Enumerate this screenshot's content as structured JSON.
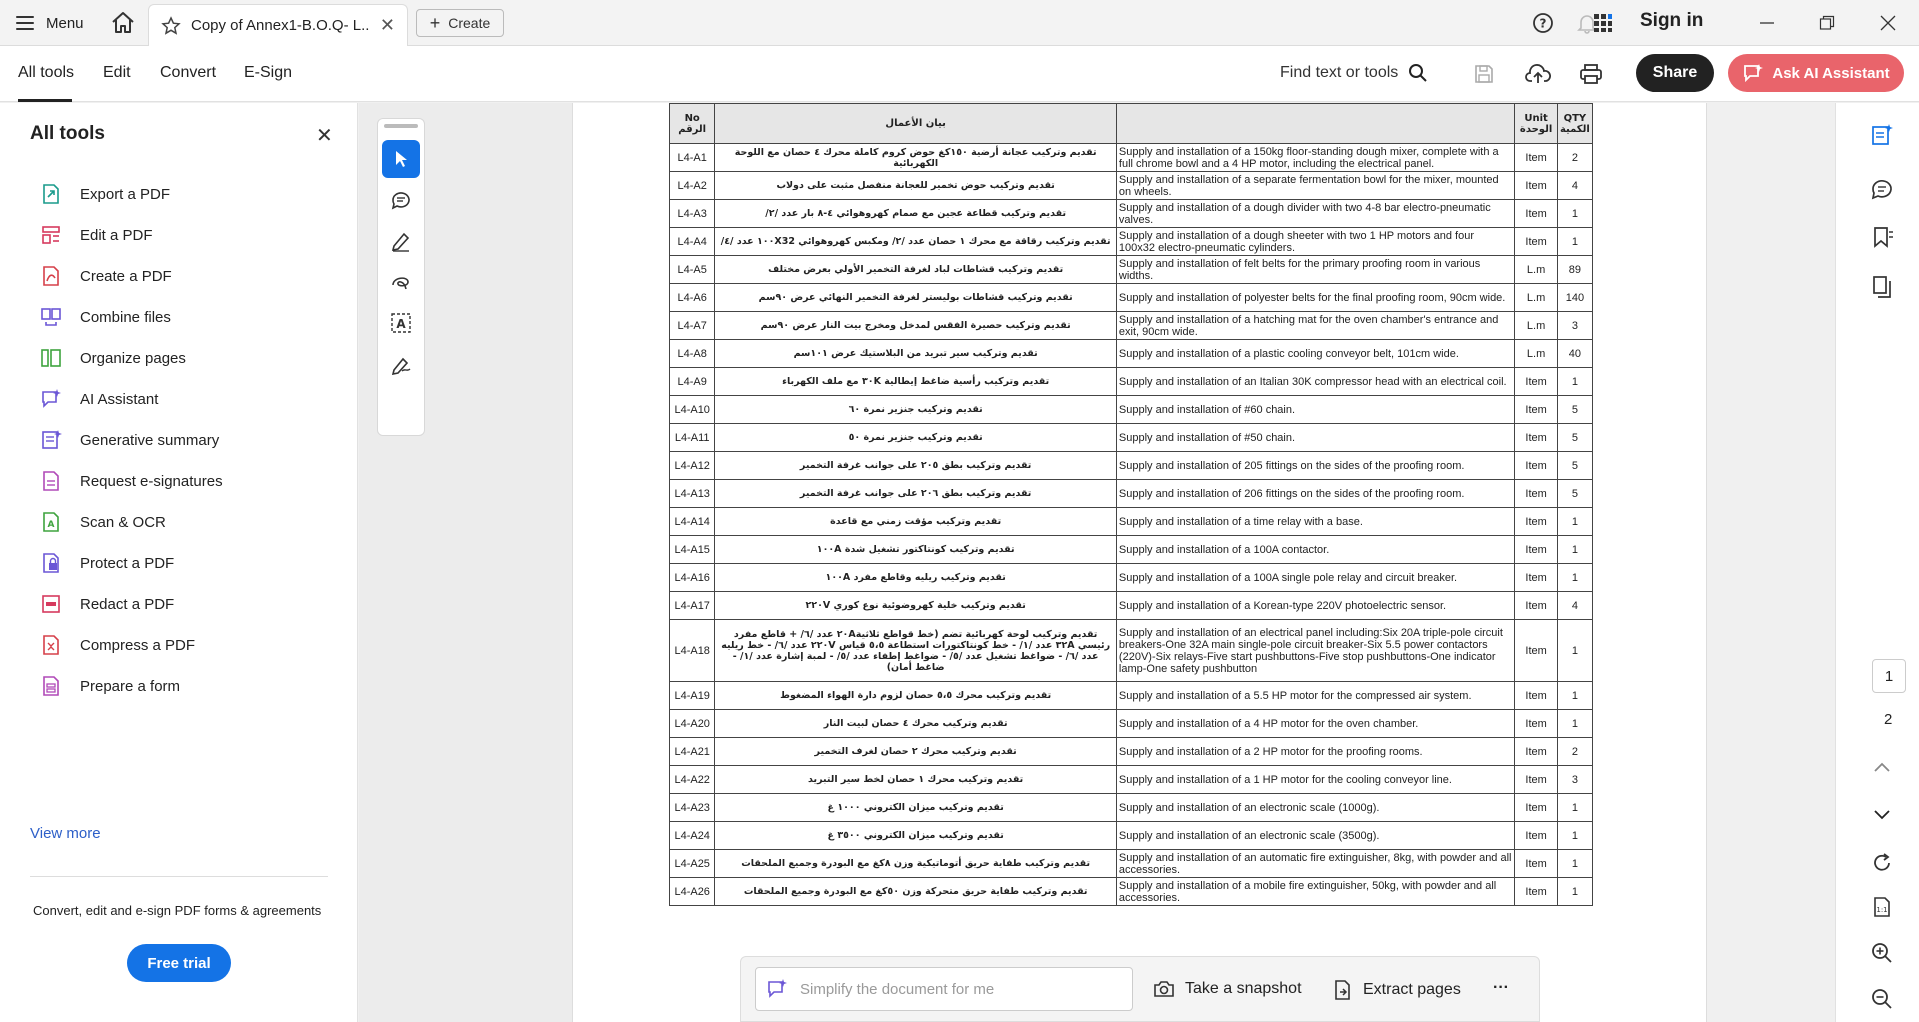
{
  "titlebar": {
    "menu_label": "Menu",
    "tab_title": "Copy of Annex1-B.O.Q- L...",
    "create_label": "Create",
    "signin_label": "Sign in"
  },
  "toolbar": {
    "tabs": [
      "All tools",
      "Edit",
      "Convert",
      "E-Sign"
    ],
    "find_label": "Find text or tools",
    "share_label": "Share",
    "ai_label": "Ask AI Assistant"
  },
  "left_panel": {
    "title": "All tools",
    "items": [
      {
        "label": "Export a PDF",
        "color": "#1a9b8c"
      },
      {
        "label": "Edit a PDF",
        "color": "#d63a5e"
      },
      {
        "label": "Create a PDF",
        "color": "#d6404a"
      },
      {
        "label": "Combine files",
        "color": "#6b57d6"
      },
      {
        "label": "Organize pages",
        "color": "#3ea33e"
      },
      {
        "label": "AI Assistant",
        "color": "#6b57d6"
      },
      {
        "label": "Generative summary",
        "color": "#6b57d6"
      },
      {
        "label": "Request e-signatures",
        "color": "#b14ab8"
      },
      {
        "label": "Scan & OCR",
        "color": "#3ea33e"
      },
      {
        "label": "Protect a PDF",
        "color": "#6b57d6"
      },
      {
        "label": "Redact a PDF",
        "color": "#d63a5e"
      },
      {
        "label": "Compress a PDF",
        "color": "#d6404a"
      },
      {
        "label": "Prepare a form",
        "color": "#b14ab8"
      }
    ],
    "view_more": "View more",
    "tagline": "Convert, edit and e-sign PDF forms & agreements",
    "trial_label": "Free trial"
  },
  "table": {
    "headers": {
      "no": "No\nالرقم",
      "ar": "بيان الأعمال",
      "en": "",
      "unit": "Unit\nالوحدة",
      "qty": "QTY\nالكمية"
    },
    "rows": [
      {
        "no": "L4-A1",
        "ar": "تقديم وتركيب عجانة أرضية ١٥٠كغ حوض كروم كاملة محرك ٤ حصان مع اللوحة الكهربائية",
        "en": "Supply and installation of a 150kg floor-standing dough mixer, complete with a full chrome bowl and a 4 HP motor, including the electrical panel.",
        "unit": "Item",
        "qty": "2"
      },
      {
        "no": "L4-A2",
        "ar": "تقديم وتركيب حوض تخمير للعجانة منفصل مثبت على دولاب",
        "en": "Supply and installation of a separate fermentation bowl for the mixer, mounted on wheels.",
        "unit": "Item",
        "qty": "4"
      },
      {
        "no": "L4-A3",
        "ar": "تقديم وتركيب قطاعة عجين مع صمام كهروهوائي ٤-٨ بار عدد /٢/",
        "en": "Supply and installation of a dough divider with two 4-8 bar electro-pneumatic valves.",
        "unit": "Item",
        "qty": "1"
      },
      {
        "no": "L4-A4",
        "ar": "تقديم وتركيب رقاقة مع محرك ١ حصان عدد /٢/ ومكبس كهروهوائي ١٠٠X32 عدد /٤/",
        "en": "Supply and installation of a dough sheeter with two 1 HP motors and four 100x32 electro-pneumatic cylinders.",
        "unit": "Item",
        "qty": "1"
      },
      {
        "no": "L4-A5",
        "ar": "تقديم وتركيب قشاطات لباد لغرفة التخمير الأولي بعرض مختلف",
        "en": "Supply and installation of felt belts for the primary proofing room in various widths.",
        "unit": "L.m",
        "qty": "89"
      },
      {
        "no": "L4-A6",
        "ar": "تقديم وتركيب قشاطات بوليستر لغرفة التخمير النهائي عرض ٩٠سم",
        "en": "Supply and installation of polyester belts for the final proofing room, 90cm wide.",
        "unit": "L.m",
        "qty": "140"
      },
      {
        "no": "L4-A7",
        "ar": "تقديم وتركيب حصيرة الفقس لمدخل ومخرج بيت النار عرض ٩٠سم",
        "en": "Supply and installation of a hatching mat for the oven chamber's entrance and exit, 90cm wide.",
        "unit": "L.m",
        "qty": "3"
      },
      {
        "no": "L4-A8",
        "ar": "تقديم وتركيب سير تبريد من البلاستيك عرض ١٠١سم",
        "en": "Supply and installation of a plastic cooling conveyor belt, 101cm wide.",
        "unit": "L.m",
        "qty": "40"
      },
      {
        "no": "L4-A9",
        "ar": "تقديم وتركيب رأسية ضاغط إيطالية ٣٠K مع ملف الكهرباء",
        "en": "Supply and installation of an Italian 30K compressor head with an electrical coil.",
        "unit": "Item",
        "qty": "1"
      },
      {
        "no": "L4-A10",
        "ar": "تقديم وتركيب جنزير نمرة ٦٠",
        "en": "Supply and installation of #60 chain.",
        "unit": "Item",
        "qty": "5"
      },
      {
        "no": "L4-A11",
        "ar": "تقديم وتركيب جنزير نمرة ٥٠",
        "en": "Supply and installation of #50 chain.",
        "unit": "Item",
        "qty": "5"
      },
      {
        "no": "L4-A12",
        "ar": "تقديم وتركيب بطق ٢٠٥ على جوانب غرفة التخمير",
        "en": "Supply and installation of 205 fittings on the sides of the proofing room.",
        "unit": "Item",
        "qty": "5"
      },
      {
        "no": "L4-A13",
        "ar": "تقديم وتركيب بطق ٢٠٦ على جوانب غرفة التخمير",
        "en": "Supply and installation of 206 fittings on the sides of the proofing room.",
        "unit": "Item",
        "qty": "5"
      },
      {
        "no": "L4-A14",
        "ar": "تقديم وتركيب مؤقت زمني مع قاعدة",
        "en": "Supply and installation of a time relay with a base.",
        "unit": "Item",
        "qty": "1"
      },
      {
        "no": "L4-A15",
        "ar": "تقديم وتركيب كونتاكتور تشغيل شدة ١٠٠A",
        "en": "Supply and installation of a 100A contactor.",
        "unit": "Item",
        "qty": "1"
      },
      {
        "no": "L4-A16",
        "ar": "تقديم وتركيب ريليه وقاطع مفرد ١٠٠A",
        "en": "Supply and installation of a 100A single pole relay and circuit breaker.",
        "unit": "Item",
        "qty": "1"
      },
      {
        "no": "L4-A17",
        "ar": "تقديم وتركيب خلية كهروضوئية نوع كوري ٢٢٠V",
        "en": "Supply and installation of a Korean-type 220V photoelectric sensor.",
        "unit": "Item",
        "qty": "4"
      },
      {
        "no": "L4-A18",
        "ar": "تقديم وتركيب لوحة كهربائية تضم (خط قواطع ثلاثية٢٠A عدد /٦/ + قاطع مفرد رئيسي ٣٢A عدد /١/ - خط كونتاكتورات استطاعة ٥،٥ قياس ٢٢٠V عدد /٦/ - خط ريليه عدد /٦/ - ضواغط تشغيل عدد /٥/ - ضواغط إطفاء عدد /٥/ - لمبة إشارة عدد /١/ - ضاغط أمان)",
        "en": "Supply and installation of an electrical panel including:Six 20A triple-pole circuit breakers-One 32A main single-pole circuit breaker-Six 5.5 power contactors (220V)-Six relays-Five start pushbuttons-Five stop pushbuttons-One indicator lamp-One safety pushbutton",
        "unit": "Item",
        "qty": "1",
        "tall": true
      },
      {
        "no": "L4-A19",
        "ar": "تقديم وتركيب محرك ٥،٥ حصان لزوم دارة الهواء المضغوط",
        "en": "Supply and installation of a 5.5 HP motor for the compressed air system.",
        "unit": "Item",
        "qty": "1"
      },
      {
        "no": "L4-A20",
        "ar": "تقديم وتركيب محرك ٤ حصان لبيت النار",
        "en": "Supply and installation of a 4 HP motor for the oven chamber.",
        "unit": "Item",
        "qty": "1"
      },
      {
        "no": "L4-A21",
        "ar": "تقديم وتركيب محرك ٢ حصان لغرف التخمير",
        "en": "Supply and installation of a 2 HP motor for the proofing rooms.",
        "unit": "Item",
        "qty": "2"
      },
      {
        "no": "L4-A22",
        "ar": "تقديم وتركيب محرك ١ حصان لخط سير التبريد",
        "en": "Supply and installation of a 1 HP motor for the cooling conveyor line.",
        "unit": "Item",
        "qty": "3"
      },
      {
        "no": "L4-A23",
        "ar": "تقديم وتركيب ميزان الكتروني ١٠٠٠ غ",
        "en": "Supply and installation of an electronic scale (1000g).",
        "unit": "Item",
        "qty": "1"
      },
      {
        "no": "L4-A24",
        "ar": "تقديم وتركيب ميزان الكتروني ٣٥٠٠ غ",
        "en": "Supply and installation of an electronic scale (3500g).",
        "unit": "Item",
        "qty": "1"
      },
      {
        "no": "L4-A25",
        "ar": "تقديم وتركيب طفاية حريق أتوماتيكية وزن ٨كغ مع البودرة وجميع الملحقات",
        "en": "Supply and installation of an automatic fire extinguisher, 8kg, with powder and all accessories.",
        "unit": "Item",
        "qty": "1"
      },
      {
        "no": "L4-A26",
        "ar": "تقديم وتركيب طفاية حريق متحركة وزن ٥٠كغ مع البودرة وجميع الملحقات",
        "en": "Supply and installation of a mobile fire extinguisher, 50kg, with powder and all accessories.",
        "unit": "Item",
        "qty": "1"
      }
    ]
  },
  "aibar": {
    "placeholder": "Simplify the document for me",
    "snapshot_label": "Take a snapshot",
    "extract_label": "Extract pages",
    "more_label": "···"
  },
  "pages": {
    "current": "1",
    "next": "2"
  }
}
